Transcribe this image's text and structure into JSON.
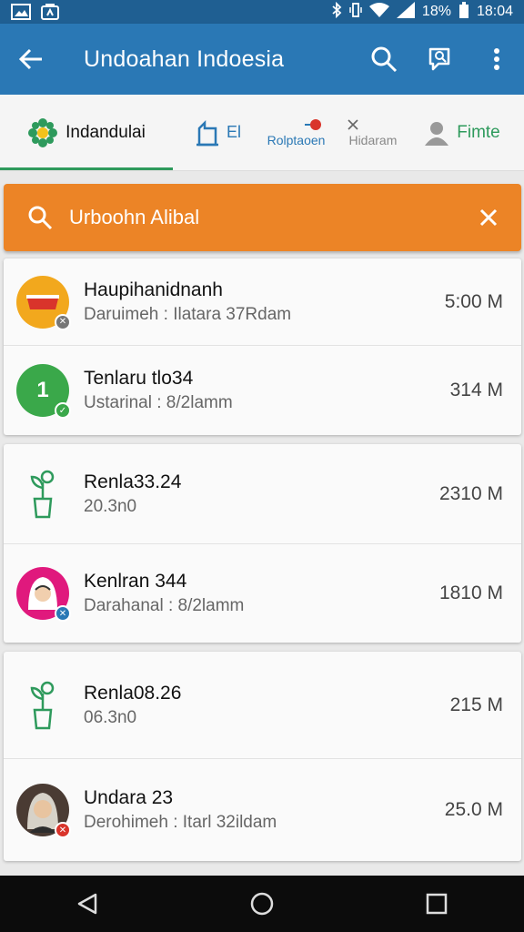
{
  "status_bar": {
    "battery": "18%",
    "time": "18:04"
  },
  "app_bar": {
    "title": "Undoahan Indoesia"
  },
  "tabs": [
    {
      "label": "Indandulai",
      "active": true
    },
    {
      "label": "El"
    },
    {
      "label": "Rolptaoen",
      "label2": "Hidaram"
    },
    {
      "label": "Fimte"
    }
  ],
  "search": {
    "query": "Urboohn Alibal"
  },
  "items": [
    {
      "name": "Haupihanidnanh",
      "sub": "Daruimeh : Ilatara 37Rdam",
      "size": "5:00 M"
    },
    {
      "name": "Tenlaru tlo34",
      "sub": "Ustarinal : 8/2lamm",
      "size": "314 M"
    },
    {
      "name": "Renla33.24",
      "sub": "20.3n0",
      "size": "2310 M"
    },
    {
      "name": "Kenlran 344",
      "sub": "Darahanal : 8/2lamm",
      "size": "1810 M"
    },
    {
      "name": "Renla08.26",
      "sub": "06.3n0",
      "size": "215 M"
    },
    {
      "name": "Undara 23",
      "sub": "Derohimeh : Itarl 32ildam",
      "size": "25.0 M"
    }
  ],
  "colors": {
    "status": "#1f5f92",
    "appbar": "#2a78b5",
    "accent_green": "#2e9a5c",
    "search_orange": "#ec8426"
  }
}
